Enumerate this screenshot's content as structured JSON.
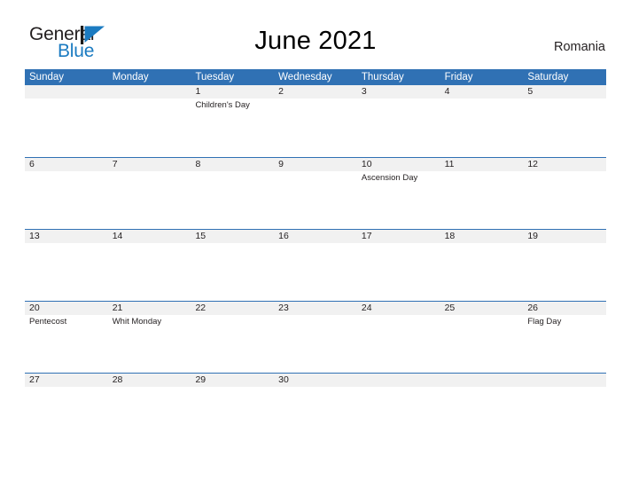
{
  "brand": {
    "line1": "General",
    "line2": "Blue",
    "mark": "flag-triangle-icon",
    "color_dark": "#231f20",
    "color_blue": "#1b7bc1"
  },
  "header": {
    "title": "June 2021",
    "country": "Romania"
  },
  "theme": {
    "header_blue": "#3071b4",
    "row_band": "#f1f1f1",
    "text": "#231f20"
  },
  "calendar": {
    "weekday_headers": [
      "Sunday",
      "Monday",
      "Tuesday",
      "Wednesday",
      "Thursday",
      "Friday",
      "Saturday"
    ],
    "weeks": [
      {
        "days": [
          {
            "num": "",
            "events": []
          },
          {
            "num": "",
            "events": []
          },
          {
            "num": "1",
            "events": [
              "Children's Day"
            ]
          },
          {
            "num": "2",
            "events": []
          },
          {
            "num": "3",
            "events": []
          },
          {
            "num": "4",
            "events": []
          },
          {
            "num": "5",
            "events": []
          }
        ]
      },
      {
        "days": [
          {
            "num": "6",
            "events": []
          },
          {
            "num": "7",
            "events": []
          },
          {
            "num": "8",
            "events": []
          },
          {
            "num": "9",
            "events": []
          },
          {
            "num": "10",
            "events": [
              "Ascension Day"
            ]
          },
          {
            "num": "11",
            "events": []
          },
          {
            "num": "12",
            "events": []
          }
        ]
      },
      {
        "days": [
          {
            "num": "13",
            "events": []
          },
          {
            "num": "14",
            "events": []
          },
          {
            "num": "15",
            "events": []
          },
          {
            "num": "16",
            "events": []
          },
          {
            "num": "17",
            "events": []
          },
          {
            "num": "18",
            "events": []
          },
          {
            "num": "19",
            "events": []
          }
        ]
      },
      {
        "days": [
          {
            "num": "20",
            "events": [
              "Pentecost"
            ]
          },
          {
            "num": "21",
            "events": [
              "Whit Monday"
            ]
          },
          {
            "num": "22",
            "events": []
          },
          {
            "num": "23",
            "events": []
          },
          {
            "num": "24",
            "events": []
          },
          {
            "num": "25",
            "events": []
          },
          {
            "num": "26",
            "events": [
              "Flag Day"
            ]
          }
        ]
      },
      {
        "days": [
          {
            "num": "27",
            "events": []
          },
          {
            "num": "28",
            "events": []
          },
          {
            "num": "29",
            "events": []
          },
          {
            "num": "30",
            "events": []
          },
          {
            "num": "",
            "events": []
          },
          {
            "num": "",
            "events": []
          },
          {
            "num": "",
            "events": []
          }
        ]
      }
    ]
  }
}
